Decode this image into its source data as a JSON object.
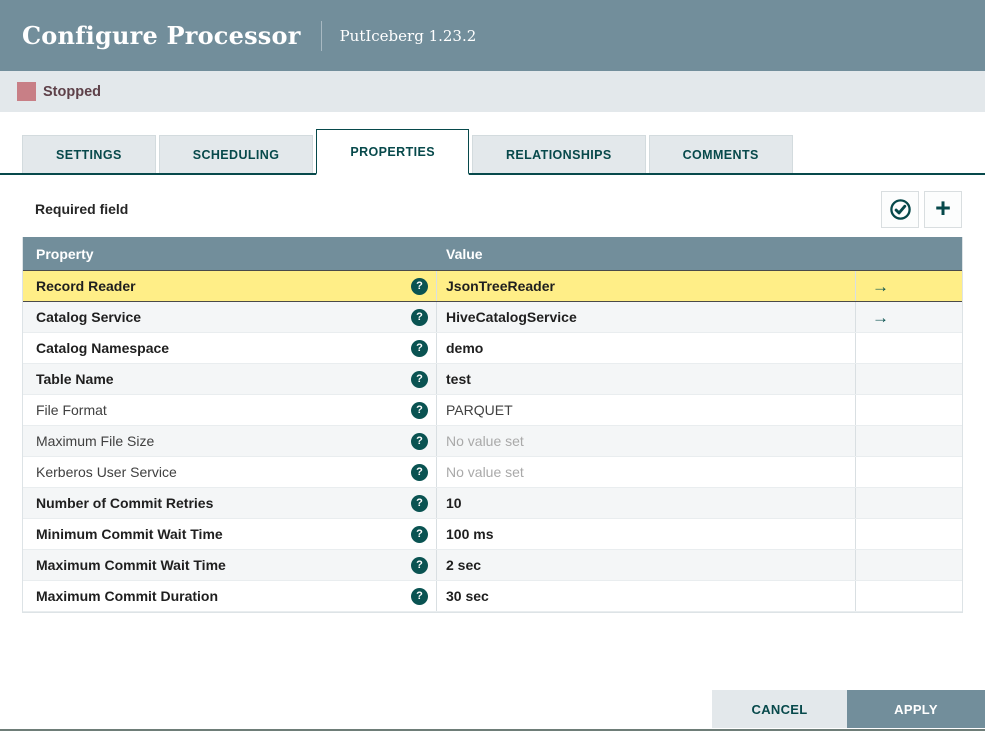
{
  "header": {
    "title": "Configure Processor",
    "subtitle": "PutIceberg 1.23.2"
  },
  "status": {
    "label": "Stopped",
    "color": "#C87F86"
  },
  "tabs": [
    {
      "label": "SETTINGS",
      "active": false
    },
    {
      "label": "SCHEDULING",
      "active": false
    },
    {
      "label": "PROPERTIES",
      "active": true
    },
    {
      "label": "RELATIONSHIPS",
      "active": false
    },
    {
      "label": "COMMENTS",
      "active": false
    }
  ],
  "toolbar": {
    "required_label": "Required field",
    "verify_icon": "check-circle-icon",
    "add_icon": "plus-icon"
  },
  "table": {
    "columns": {
      "property": "Property",
      "value": "Value"
    },
    "rows": [
      {
        "property": "Record Reader",
        "value": "JsonTreeReader",
        "bold": true,
        "selected": true,
        "has_arrow": true,
        "placeholder": false
      },
      {
        "property": "Catalog Service",
        "value": "HiveCatalogService",
        "bold": true,
        "selected": false,
        "has_arrow": true,
        "placeholder": false
      },
      {
        "property": "Catalog Namespace",
        "value": "demo",
        "bold": true,
        "selected": false,
        "has_arrow": false,
        "placeholder": false
      },
      {
        "property": "Table Name",
        "value": "test",
        "bold": true,
        "selected": false,
        "has_arrow": false,
        "placeholder": false
      },
      {
        "property": "File Format",
        "value": "PARQUET",
        "bold": false,
        "selected": false,
        "has_arrow": false,
        "placeholder": false
      },
      {
        "property": "Maximum File Size",
        "value": "No value set",
        "bold": false,
        "selected": false,
        "has_arrow": false,
        "placeholder": true
      },
      {
        "property": "Kerberos User Service",
        "value": "No value set",
        "bold": false,
        "selected": false,
        "has_arrow": false,
        "placeholder": true
      },
      {
        "property": "Number of Commit Retries",
        "value": "10",
        "bold": true,
        "selected": false,
        "has_arrow": false,
        "placeholder": false
      },
      {
        "property": "Minimum Commit Wait Time",
        "value": "100 ms",
        "bold": true,
        "selected": false,
        "has_arrow": false,
        "placeholder": false
      },
      {
        "property": "Maximum Commit Wait Time",
        "value": "2 sec",
        "bold": true,
        "selected": false,
        "has_arrow": false,
        "placeholder": false
      },
      {
        "property": "Maximum Commit Duration",
        "value": "30 sec",
        "bold": true,
        "selected": false,
        "has_arrow": false,
        "placeholder": false
      }
    ]
  },
  "footer": {
    "cancel_label": "CANCEL",
    "apply_label": "APPLY"
  },
  "colors": {
    "header_bg": "#728E9B",
    "accent_teal": "#07494B",
    "selected_row": "#FFEE87",
    "status_stopped": "#C87F86",
    "bar_bg": "#E3E8EB"
  }
}
